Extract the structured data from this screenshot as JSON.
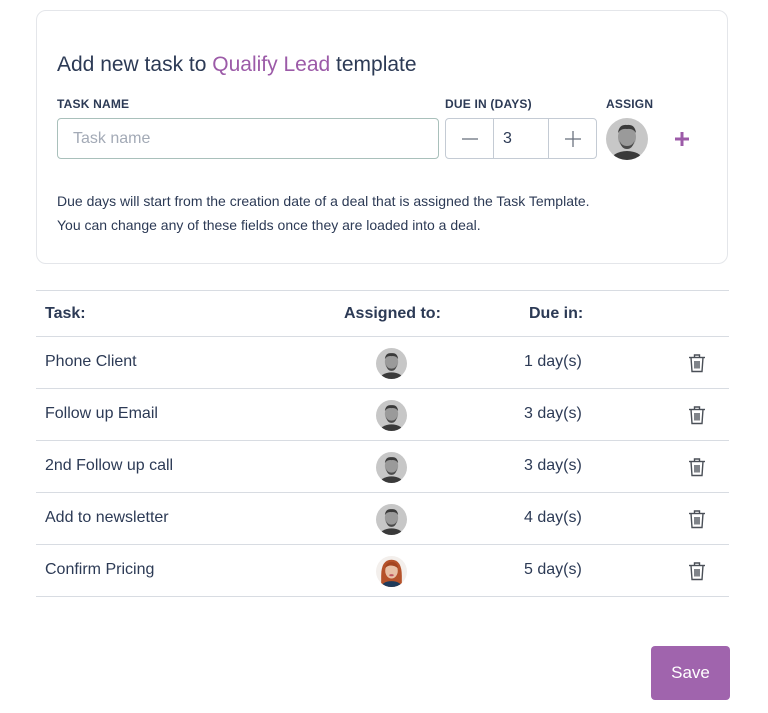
{
  "form": {
    "title_prefix": "Add new task to ",
    "template_name": "Qualify Lead",
    "title_suffix": " template",
    "task_name_label": "TASK NAME",
    "task_name_placeholder": "Task name",
    "task_name_value": "",
    "due_label": "DUE IN (DAYS)",
    "due_value": "3",
    "assign_label": "ASSIGN",
    "note_line1": "Due days will start from the creation date of a deal that is assigned the Task Template.",
    "note_line2": "You can change any of these fields once they are loaded into a deal."
  },
  "table": {
    "headers": {
      "task": "Task:",
      "assigned": "Assigned to:",
      "due": "Due in:"
    },
    "rows": [
      {
        "task": "Phone Client",
        "due": "1 day(s)",
        "avatar": "male-avatar"
      },
      {
        "task": "Follow up Email",
        "due": "3 day(s)",
        "avatar": "male-avatar"
      },
      {
        "task": "2nd Follow up call",
        "due": "3 day(s)",
        "avatar": "male-avatar"
      },
      {
        "task": "Add to newsletter",
        "due": "4 day(s)",
        "avatar": "male-avatar"
      },
      {
        "task": "Confirm Pricing",
        "due": "5 day(s)",
        "avatar": "female-avatar"
      }
    ]
  },
  "actions": {
    "save_label": "Save"
  },
  "colors": {
    "accent": "#a064ad",
    "text": "#2c3a55",
    "border": "#d8dce2"
  },
  "icons": {
    "delete": "trash-icon",
    "add": "plus-icon",
    "decrement": "minus-icon",
    "increment": "plus-icon"
  }
}
